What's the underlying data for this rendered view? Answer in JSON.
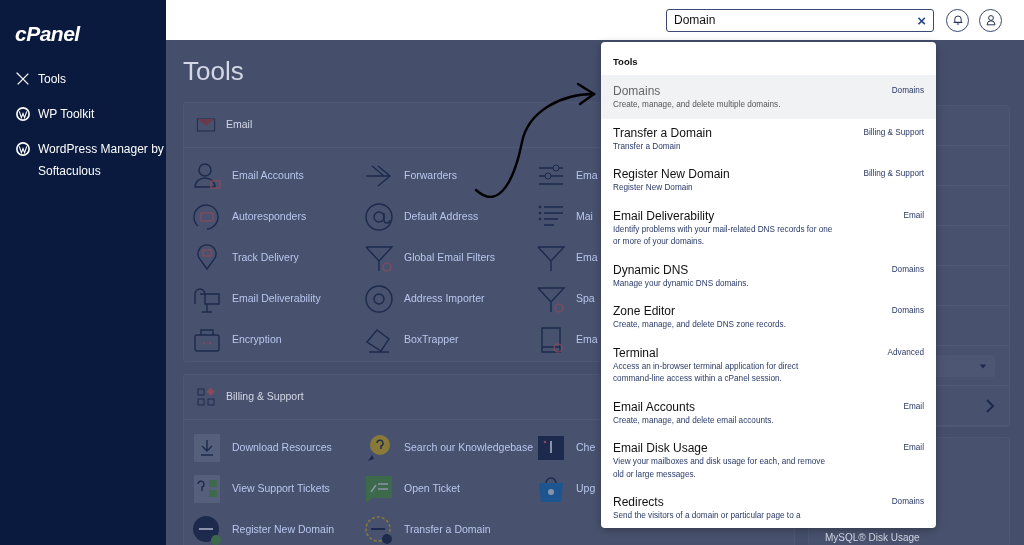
{
  "sidebar": {
    "logo": "cPanel",
    "items": [
      {
        "label": "Tools"
      },
      {
        "label": "WP Toolkit"
      },
      {
        "label": "WordPress Manager by Softaculous"
      }
    ]
  },
  "header": {
    "search": {
      "value": "Domain",
      "clear": "×"
    }
  },
  "page_title": "Tools",
  "sections": [
    {
      "title": "Email",
      "tools": [
        "Email Accounts",
        "Forwarders",
        "Ema",
        "Autoresponders",
        "Default Address",
        "Mai",
        "Track Delivery",
        "Global Email Filters",
        "Ema",
        "Email Deliverability",
        "Address Importer",
        "Spa",
        "Encryption",
        "BoxTrapper",
        "Ema"
      ]
    },
    {
      "title": "Billing & Support",
      "tools": [
        "Download Resources",
        "Search our Knowledgebase",
        "Che",
        "View Support Tickets",
        "Open Ticket",
        "Upg",
        "Register New Domain",
        "Transfer a Domain"
      ]
    }
  ],
  "side_panel": {
    "footer_item": "MySQL® Disk Usage"
  },
  "dropdown": {
    "heading": "Tools",
    "results": [
      {
        "title": "Domains",
        "description": "Create, manage, and delete multiple domains.",
        "category": "Domains",
        "selected": true
      },
      {
        "title": "Transfer a Domain",
        "description": "Transfer a Domain",
        "category": "Billing & Support",
        "selected": false
      },
      {
        "title": "Register New Domain",
        "description": "Register New Domain",
        "category": "Billing & Support",
        "selected": false
      },
      {
        "title": "Email Deliverability",
        "description": "Identify problems with your mail-related DNS records for one or more of your domains.",
        "category": "Email",
        "selected": false
      },
      {
        "title": "Dynamic DNS",
        "description": "Manage your dynamic DNS domains.",
        "category": "Domains",
        "selected": false
      },
      {
        "title": "Zone Editor",
        "description": "Create, manage, and delete DNS zone records.",
        "category": "Domains",
        "selected": false
      },
      {
        "title": "Terminal",
        "description": "Access an in-browser terminal application for direct command-line access within a cPanel session.",
        "category": "Advanced",
        "selected": false
      },
      {
        "title": "Email Accounts",
        "description": "Create, manage, and delete email accounts.",
        "category": "Email",
        "selected": false
      },
      {
        "title": "Email Disk Usage",
        "description": "View your mailboxes and disk usage for each, and remove old or large messages.",
        "category": "Email",
        "selected": false
      },
      {
        "title": "Redirects",
        "description": "Send the visitors of a domain or particular page to a",
        "category": "Domains",
        "selected": false
      }
    ]
  }
}
